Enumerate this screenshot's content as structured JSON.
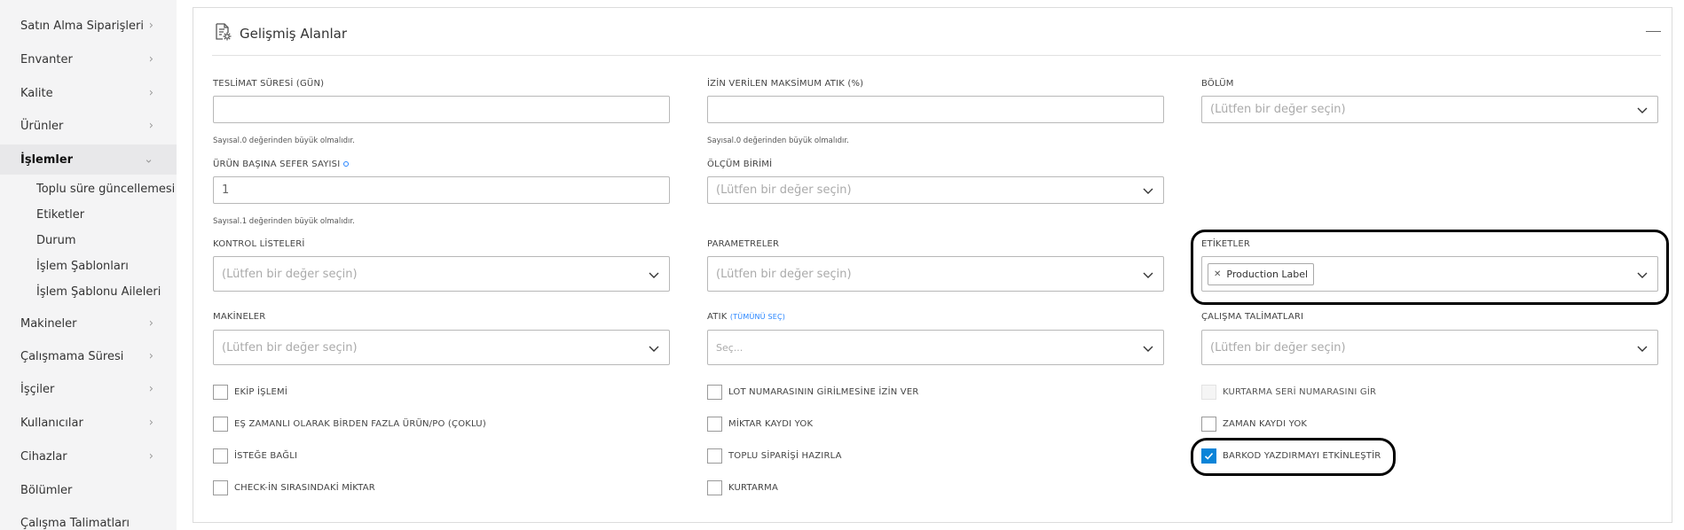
{
  "sidebar": {
    "items": [
      {
        "label": "Satın Alma Siparişleri",
        "chevron": "›"
      },
      {
        "label": "Envanter",
        "chevron": "›"
      },
      {
        "label": "Kalite",
        "chevron": "›"
      },
      {
        "label": "Ürünler",
        "chevron": "›"
      },
      {
        "label": "İşlemler",
        "chevron": "⌄"
      },
      {
        "label": "Makineler",
        "chevron": "›"
      },
      {
        "label": "Çalışmama Süresi",
        "chevron": "›"
      },
      {
        "label": "İşçiler",
        "chevron": "›"
      },
      {
        "label": "Kullanıcılar",
        "chevron": "›"
      },
      {
        "label": "Cihazlar",
        "chevron": "›"
      },
      {
        "label": "Bölümler",
        "chevron": ""
      },
      {
        "label": "Çalışma Talimatları",
        "chevron": ""
      }
    ],
    "subitems": [
      "Toplu süre güncellemesi",
      "Etiketler",
      "Durum",
      "İşlem Şablonları",
      "İşlem Şablonu Aileleri"
    ]
  },
  "panel": {
    "title": "Gelişmiş Alanlar"
  },
  "fields": {
    "teslimat": {
      "label": "TESLİMAT SÜRESİ (GÜN)",
      "value": "",
      "hint": "Sayısal.0 değerinden büyük olmalıdır."
    },
    "atik_max": {
      "label": "İZİN VERİLEN MAKSİMUM ATIK (%)",
      "value": "",
      "hint": "Sayısal.0 değerinden büyük olmalıdır."
    },
    "bolum": {
      "label": "BÖLÜM",
      "placeholder": "(Lütfen bir değer seçin)"
    },
    "sefer": {
      "label": "ÜRÜN BAŞINA SEFER SAYISI",
      "value": "1",
      "hint": "Sayısal.1 değerinden büyük olmalıdır."
    },
    "olcum": {
      "label": "ÖLÇÜM BİRİMİ",
      "placeholder": "(Lütfen bir değer seçin)"
    },
    "kontrol": {
      "label": "KONTROL LİSTELERİ",
      "placeholder": "(Lütfen bir değer seçin)"
    },
    "parametreler": {
      "label": "PARAMETRELER",
      "placeholder": "(Lütfen bir değer seçin)"
    },
    "etiketler": {
      "label": "ETİKETLER",
      "tag": "Production Label"
    },
    "makineler": {
      "label": "MAKİNELER",
      "placeholder": "(Lütfen bir değer seçin)"
    },
    "atik": {
      "label": "ATIK",
      "link": "(TÜMÜNÜ SEÇ)",
      "placeholder": "Seç..."
    },
    "talimatlar": {
      "label": "ÇALIŞMA TALİMATLARI",
      "placeholder": "(Lütfen bir değer seçin)"
    }
  },
  "checkboxes": {
    "col1": [
      {
        "label": "EKİP İŞLEMİ",
        "checked": false
      },
      {
        "label": "EŞ ZAMANLI OLARAK BİRDEN FAZLA ÜRÜN/PO (ÇOKLU)",
        "checked": false
      },
      {
        "label": "İSTEĞE BAĞLI",
        "checked": false
      },
      {
        "label": "CHECK-İN SIRASINDAKİ MİKTAR",
        "checked": false
      }
    ],
    "col2": [
      {
        "label": "LOT NUMARASININ GİRİLMESİNE İZİN VER",
        "checked": false
      },
      {
        "label": "MİKTAR KAYDI YOK",
        "checked": false
      },
      {
        "label": "TOPLU SİPARİŞİ HAZIRLA",
        "checked": false
      },
      {
        "label": "KURTARMA",
        "checked": false
      }
    ],
    "col3": [
      {
        "label": "KURTARMA SERİ NUMARASINI GİR",
        "checked": false,
        "disabled": true
      },
      {
        "label": "ZAMAN KAYDI YOK",
        "checked": false
      },
      {
        "label": "BARKOD YAZDIRMAYI ETKİNLEŞTİR",
        "checked": true
      }
    ]
  },
  "icons": {
    "panel": "settings-document-icon",
    "dropdown": "chevron-down-icon",
    "tag_remove": "close-icon",
    "check": "checkmark-icon"
  },
  "colors": {
    "accent": "#0a84d8",
    "link": "#2684ff",
    "highlight": "#000000"
  }
}
